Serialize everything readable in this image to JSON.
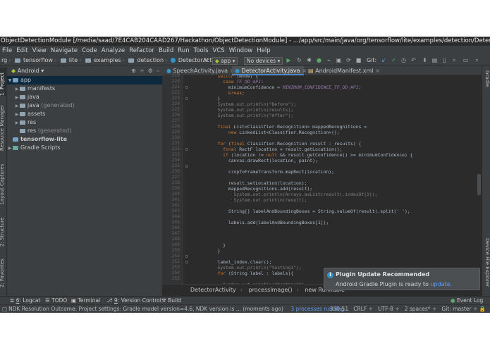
{
  "window": {
    "title": "ObjectDetectionModule [/media/saad/7E4CAB204CAAD267/Hackathon/ObjectDetectionModule] - .../app/src/main/java/org/tensorflow/lite/examples/detection/DetectorAc..."
  },
  "menu": [
    "File",
    "Edit",
    "View",
    "Navigate",
    "Code",
    "Analyze",
    "Refactor",
    "Build",
    "Run",
    "Tools",
    "VCS",
    "Window",
    "Help"
  ],
  "toolbar": {
    "crumbs": [
      "rg",
      "tensorflow",
      "lite",
      "examples",
      "detection",
      "DetectorActivity"
    ],
    "run_config": "app",
    "device": "No devices",
    "git_label": "Git:"
  },
  "left_strip": {
    "items": [
      "1: Project",
      "Resource Manager",
      "Layout Captures",
      "2: Structure",
      "2: Favorites"
    ]
  },
  "project": {
    "view": "Android",
    "items": [
      {
        "label": "app",
        "extra": ""
      },
      {
        "label": "manifests",
        "extra": ""
      },
      {
        "label": "java",
        "extra": ""
      },
      {
        "label": "java",
        "extra": "(generated)"
      },
      {
        "label": "assets",
        "extra": ""
      },
      {
        "label": "res",
        "extra": ""
      },
      {
        "label": "res",
        "extra": "(generated)"
      },
      {
        "label": "tensorflow-lite",
        "extra": ""
      },
      {
        "label": "Gradle Scripts",
        "extra": ""
      }
    ]
  },
  "tabs": [
    "SpeechActivity.java",
    "DetectorActivity.java",
    "AndroidManifest.xml"
  ],
  "code": {
    "line_numbers": [
      "219",
      "220",
      "221",
      "222",
      "223",
      "224",
      "225",
      "226",
      "227",
      "228",
      "229",
      "230",
      "231",
      "232",
      "233",
      "234",
      "235",
      "236",
      "237",
      "238",
      "239",
      "240",
      "241",
      "242",
      "243",
      "244",
      "245",
      "246",
      "247",
      "248",
      "249",
      "250",
      "251",
      "252",
      "253",
      "254",
      "255"
    ],
    "lines": [
      "          switch (mode) {",
      "            case TF_OD_API:",
      "              minimumConfidence = MINIMUM_CONFIDENCE_TF_OD_API;",
      "              break;",
      "          }",
      "          System.out.println(\"Before\");",
      "          System.out.println(results);",
      "          System.out.println(\"After\");",
      "",
      "          final List<Classifier.Recognition> mappedRecognitions =",
      "              new LinkedList<Classifier.Recognition>();",
      "",
      "          for (final Classifier.Recognition result : results) {",
      "            final RectF location = result.getLocation();",
      "            if (location != null && result.getConfidence() >= minimumConfidence) {",
      "              canvas.drawRect(location, paint);",
      "",
      "              cropToFrameTransform.mapRect(location);",
      "",
      "              result.setLocation(location);",
      "              mappedRecognitions.add(result);",
      "                System.out.println(Arrays.asList(result).indexOf(2));",
      "                System.out.println(result);",
      "",
      "              String[] labelAndBoundingBoxes = String.valueOf(result).split(' ');",
      "",
      "              labels.add(labelAndBoundingBoxes[1]);",
      "",
      "",
      "",
      "            }",
      "          }",
      "",
      "          label_index.clear();",
      "          System.out.println(\"testing1\");",
      "          for (String label : labels){",
      "",
      "            System.out.println(\"testing2\");"
    ]
  },
  "breadcrumbs": [
    "DetectorActivity",
    "processImage()",
    "new Runnable"
  ],
  "notification": {
    "title": "Plugin Update Recommended",
    "body": "Android Gradle Plugin is ready to ",
    "link": "update."
  },
  "right_strip": {
    "items": [
      "Gradle",
      "Device File Explorer"
    ]
  },
  "bottom_tools": [
    {
      "num": "6",
      "label": "Logcat"
    },
    {
      "num": "",
      "label": "TODO"
    },
    {
      "num": "",
      "label": "Terminal"
    },
    {
      "num": "9",
      "label": "Version Control"
    },
    {
      "num": "",
      "label": "Build"
    }
  ],
  "event_log": "Event Log",
  "status": {
    "message": "NDK Resolution Outcome: Project settings: Gradle model version=4.6, NDK version is ... (moments ago)",
    "processes": "3 processes running...",
    "position": "330:51",
    "line_sep": "CRLF",
    "encoding": "UTF-8",
    "indent": "2 spaces*",
    "git": "Git: master"
  }
}
